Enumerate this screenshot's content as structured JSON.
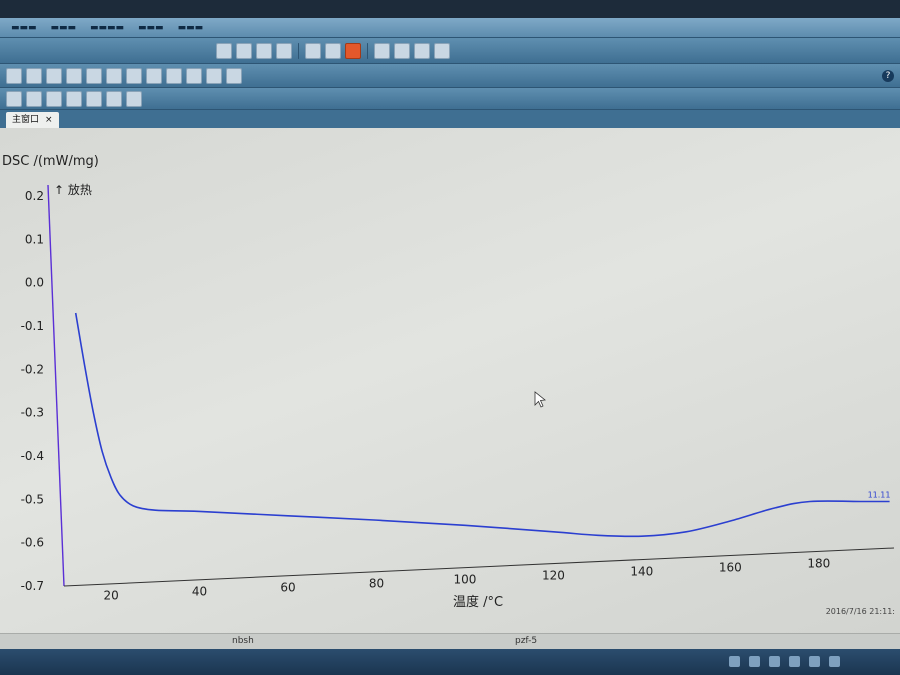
{
  "tab": {
    "label": "主窗口",
    "close": "×"
  },
  "help": "?",
  "status": {
    "left": "nbsh",
    "center": "pzf-5"
  },
  "timestamp": "2016/7/16 21:11:",
  "chart_data": {
    "type": "line",
    "ylabel": "DSC /(mW/mg)",
    "xlabel": "温度 /°C",
    "annotation": "↑ 放热",
    "curve_end_label": "11.11",
    "xlim": [
      8,
      197
    ],
    "ylim": [
      -0.7,
      0.23
    ],
    "xticks": [
      20,
      40,
      60,
      80,
      100,
      120,
      140,
      160,
      180
    ],
    "yticks": [
      0.2,
      0.1,
      0.0,
      -0.1,
      -0.2,
      -0.3,
      -0.4,
      -0.5,
      -0.6,
      -0.7
    ],
    "series": [
      {
        "color": "#2b3fd0",
        "x": [
          12,
          14,
          16,
          18,
          20,
          22,
          25,
          30,
          40,
          60,
          80,
          100,
          120,
          130,
          140,
          150,
          160,
          170,
          178,
          190,
          196
        ],
        "y": [
          -0.07,
          -0.19,
          -0.3,
          -0.39,
          -0.45,
          -0.49,
          -0.515,
          -0.525,
          -0.528,
          -0.538,
          -0.548,
          -0.56,
          -0.575,
          -0.583,
          -0.585,
          -0.575,
          -0.55,
          -0.52,
          -0.505,
          -0.505,
          -0.505
        ]
      }
    ]
  }
}
